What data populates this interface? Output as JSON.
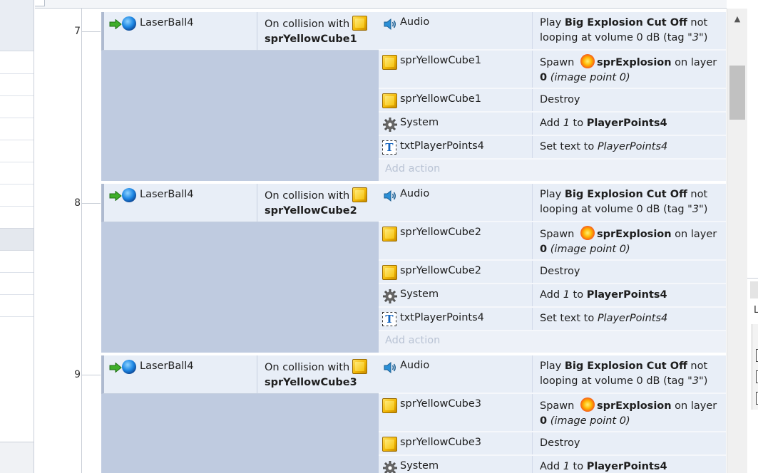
{
  "events": [
    {
      "number": "7",
      "condition": {
        "object": "LaserBall4",
        "text": "On collision with",
        "target": "sprYellowCube1"
      },
      "actions": [
        {
          "icon": "audio-icon",
          "object": "Audio",
          "desc": [
            {
              "t": "Play "
            },
            {
              "t": "Big Explosion Cut Off",
              "b": true
            },
            {
              "t": " not looping at volume 0 dB (tag "
            },
            {
              "t": "\"3\"",
              "i": true
            },
            {
              "t": ")"
            }
          ]
        },
        {
          "icon": "yellow-cube-icon",
          "object": "sprYellowCube1",
          "desc": [
            {
              "t": "Spawn "
            },
            {
              "icon": "explosion-icon"
            },
            {
              "t": "sprExplosion",
              "b": true
            },
            {
              "t": " on layer "
            },
            {
              "t": "0",
              "b": true
            },
            {
              "t": " "
            },
            {
              "t": "(image point 0)",
              "i": true
            }
          ]
        },
        {
          "icon": "yellow-cube-icon",
          "object": "sprYellowCube1",
          "desc": [
            {
              "t": "Destroy"
            }
          ]
        },
        {
          "icon": "gear-icon",
          "object": "System",
          "desc": [
            {
              "t": "Add "
            },
            {
              "t": "1",
              "i": true
            },
            {
              "t": " to "
            },
            {
              "t": "PlayerPoints4",
              "b": true
            }
          ]
        },
        {
          "icon": "text-object-icon",
          "object": "txtPlayerPoints4",
          "desc": [
            {
              "t": "Set text to  "
            },
            {
              "t": "PlayerPoints4",
              "i": true
            }
          ]
        }
      ],
      "add_action": "Add action"
    },
    {
      "number": "8",
      "condition": {
        "object": "LaserBall4",
        "text": "On collision with",
        "target": "sprYellowCube2"
      },
      "actions": [
        {
          "icon": "audio-icon",
          "object": "Audio",
          "desc": [
            {
              "t": "Play "
            },
            {
              "t": "Big Explosion Cut Off",
              "b": true
            },
            {
              "t": " not looping at volume 0 dB (tag "
            },
            {
              "t": "\"3\"",
              "i": true
            },
            {
              "t": ")"
            }
          ]
        },
        {
          "icon": "yellow-cube-icon",
          "object": "sprYellowCube2",
          "desc": [
            {
              "t": "Spawn "
            },
            {
              "icon": "explosion-icon"
            },
            {
              "t": "sprExplosion",
              "b": true
            },
            {
              "t": " on layer "
            },
            {
              "t": "0",
              "b": true
            },
            {
              "t": " "
            },
            {
              "t": "(image point 0)",
              "i": true
            }
          ]
        },
        {
          "icon": "yellow-cube-icon",
          "object": "sprYellowCube2",
          "desc": [
            {
              "t": "Destroy"
            }
          ]
        },
        {
          "icon": "gear-icon",
          "object": "System",
          "desc": [
            {
              "t": "Add "
            },
            {
              "t": "1",
              "i": true
            },
            {
              "t": " to "
            },
            {
              "t": "PlayerPoints4",
              "b": true
            }
          ]
        },
        {
          "icon": "text-object-icon",
          "object": "txtPlayerPoints4",
          "desc": [
            {
              "t": "Set text to  "
            },
            {
              "t": "PlayerPoints4",
              "i": true
            }
          ]
        }
      ],
      "add_action": "Add action"
    },
    {
      "number": "9",
      "condition": {
        "object": "LaserBall4",
        "text": "On collision with",
        "target": "sprYellowCube3"
      },
      "actions": [
        {
          "icon": "audio-icon",
          "object": "Audio",
          "desc": [
            {
              "t": "Play "
            },
            {
              "t": "Big Explosion Cut Off",
              "b": true
            },
            {
              "t": " not looping at volume 0 dB (tag "
            },
            {
              "t": "\"3\"",
              "i": true
            },
            {
              "t": ")"
            }
          ]
        },
        {
          "icon": "yellow-cube-icon",
          "object": "sprYellowCube3",
          "desc": [
            {
              "t": "Spawn "
            },
            {
              "icon": "explosion-icon"
            },
            {
              "t": "sprExplosion",
              "b": true
            },
            {
              "t": " on layer "
            },
            {
              "t": "0",
              "b": true
            },
            {
              "t": " "
            },
            {
              "t": "(image point 0)",
              "i": true
            }
          ]
        },
        {
          "icon": "yellow-cube-icon",
          "object": "sprYellowCube3",
          "desc": [
            {
              "t": "Destroy"
            }
          ]
        },
        {
          "icon": "gear-icon",
          "object": "System",
          "desc": [
            {
              "t": "Add "
            },
            {
              "t": "1",
              "i": true
            },
            {
              "t": " to "
            },
            {
              "t": "PlayerPoints4",
              "b": true
            }
          ]
        }
      ],
      "add_action": ""
    }
  ],
  "right_panel": {
    "label": "L"
  },
  "colors": {
    "condition_bg": "#e8eef7",
    "action_bg": "#e8eef7",
    "side_fill": "#bfcbe0",
    "add_action_text": "#b9c3d4",
    "scroll_thumb": "#c1c1c1"
  }
}
